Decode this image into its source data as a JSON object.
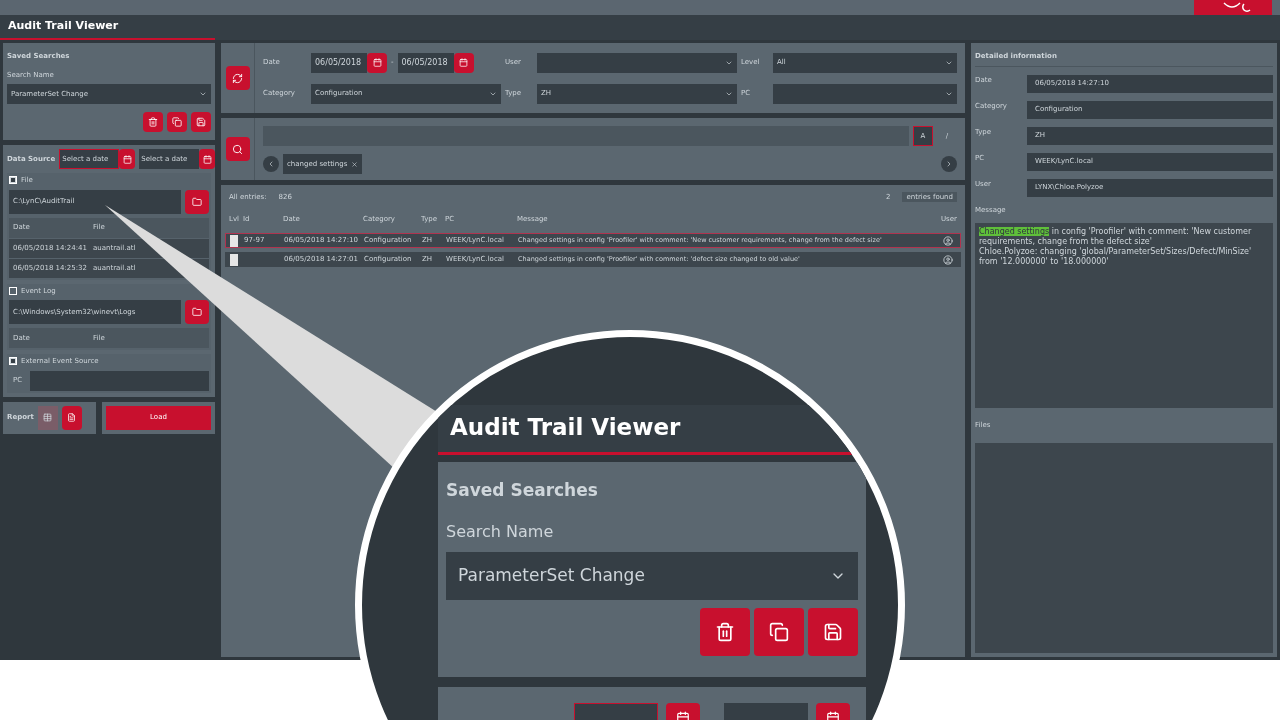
{
  "window": {
    "title": "Audit Trail Viewer"
  },
  "saved_searches": {
    "title": "Saved Searches",
    "label": "Search Name",
    "value": "ParameterSet Change"
  },
  "data_source": {
    "label": "Data Source",
    "from_placeholder": "Select a date",
    "to_placeholder": "Select a date",
    "sources": [
      {
        "kind": "files",
        "label": "File",
        "checked": true,
        "path": "C:\\LynC\\AuditTrail",
        "columns": [
          "Date",
          "File"
        ],
        "rows": [
          [
            "06/05/2018 14:24:41",
            "auantrail.atl"
          ],
          [
            "06/05/2018 14:25:32",
            "auantrail.atl"
          ]
        ]
      },
      {
        "kind": "files",
        "label": "Event Log",
        "checked": false,
        "path": "C:\\Windows\\System32\\winevt\\Logs",
        "columns": [
          "Date",
          "File"
        ]
      },
      {
        "kind": "pc",
        "label": "External Event Source",
        "checked": true,
        "field_label": "PC"
      }
    ]
  },
  "report": {
    "label": "Report",
    "load": "Load"
  },
  "filters": {
    "date_label": "Date",
    "date_from": "06/05/2018",
    "dash": "-",
    "date_to": "06/05/2018",
    "user_label": "User",
    "level_label": "Level",
    "level": "All",
    "category_label": "Category",
    "category": "Configuration",
    "type_label": "Type",
    "type": "ZH",
    "pc_label": "PC"
  },
  "search": {
    "case_button": "A",
    "regex_button": "/",
    "tag": "changed settings"
  },
  "entries": {
    "label": "All entries:",
    "count": "826",
    "found_count": "2",
    "found_label": "entries found",
    "columns": [
      "Lvl",
      "Id",
      "Date",
      "Category",
      "Type",
      "PC",
      "Message",
      "User"
    ],
    "rows": [
      {
        "selected": true,
        "id": "97-97",
        "date": "06/05/2018 14:27:10",
        "category": "Configuration",
        "type": "ZH",
        "pc": "WEEK/LynC.local",
        "message": "Changed settings in config 'Proofiler' with comment: 'New customer requirements, change from the defect size'"
      },
      {
        "selected": false,
        "id": "",
        "date": "06/05/2018 14:27:01",
        "category": "Configuration",
        "type": "ZH",
        "pc": "WEEK/LynC.local",
        "message": "Changed settings in config 'Proofiler' with comment: 'defect size changed to old value'"
      }
    ]
  },
  "details": {
    "title": "Detailed information",
    "fields": [
      {
        "label": "Date",
        "value": "06/05/2018 14:27:10"
      },
      {
        "label": "Category",
        "value": "Configuration"
      },
      {
        "label": "Type",
        "value": "ZH"
      },
      {
        "label": "PC",
        "value": "WEEK/LynC.local"
      },
      {
        "label": "User",
        "value": "LYNX\\Chloe.Polyzoe"
      }
    ],
    "message_label": "Message",
    "message_highlight": "Changed settings",
    "message_rest": "in config 'Proofiler' with comment: 'New customer requirements, change from the defect size'",
    "message_detail": "Chloe.Polyzoe: changing 'global/ParameterSet/Sizes/Defect/MinSize' from '12.000000' to '18.000000'",
    "files_label": "Files"
  },
  "magnifier": {
    "title": "Audit Trail Viewer",
    "section": "Saved Searches",
    "label": "Search Name",
    "value": "ParameterSet Change"
  }
}
